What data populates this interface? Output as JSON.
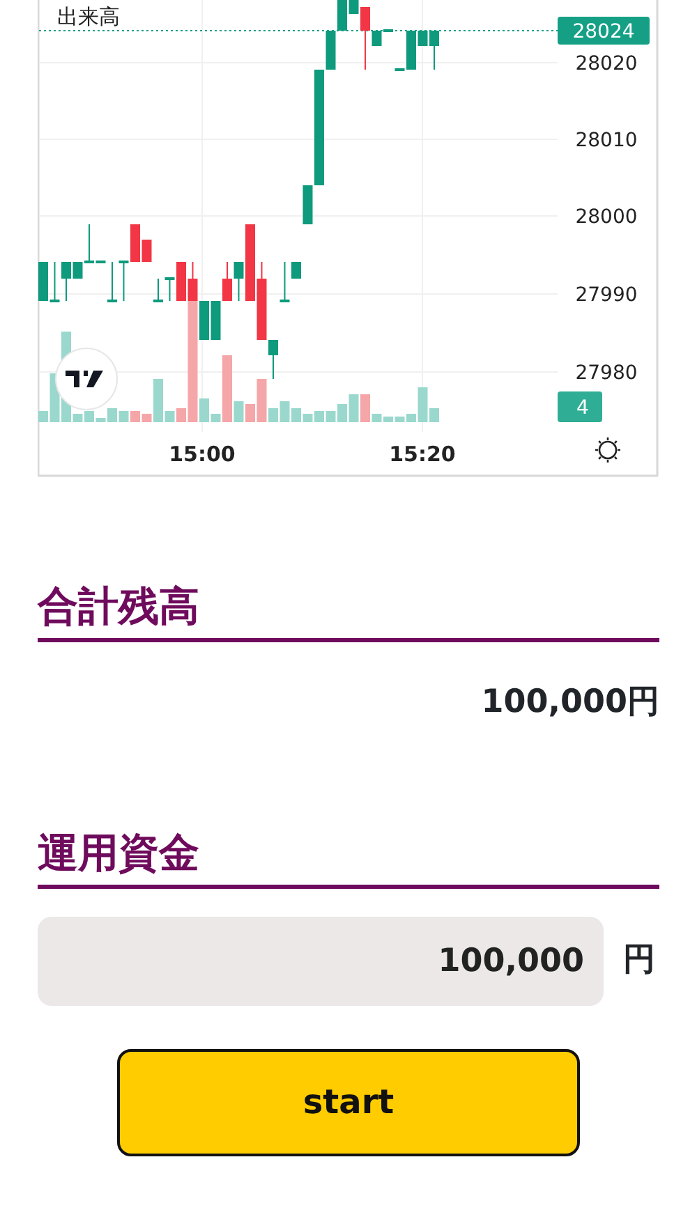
{
  "chart": {
    "legend": "出来高",
    "last_price": "28024",
    "price_labels": [
      "28020",
      "28010",
      "28000",
      "27990",
      "27980"
    ],
    "volume_reading": "4",
    "time_labels": [
      "15:00",
      "15:20"
    ]
  },
  "balance": {
    "heading": "合計残高",
    "amount": "100,000円"
  },
  "funds": {
    "heading": "運用資金",
    "value": "100,000",
    "unit": "円"
  },
  "start_button": {
    "label": "start"
  }
}
